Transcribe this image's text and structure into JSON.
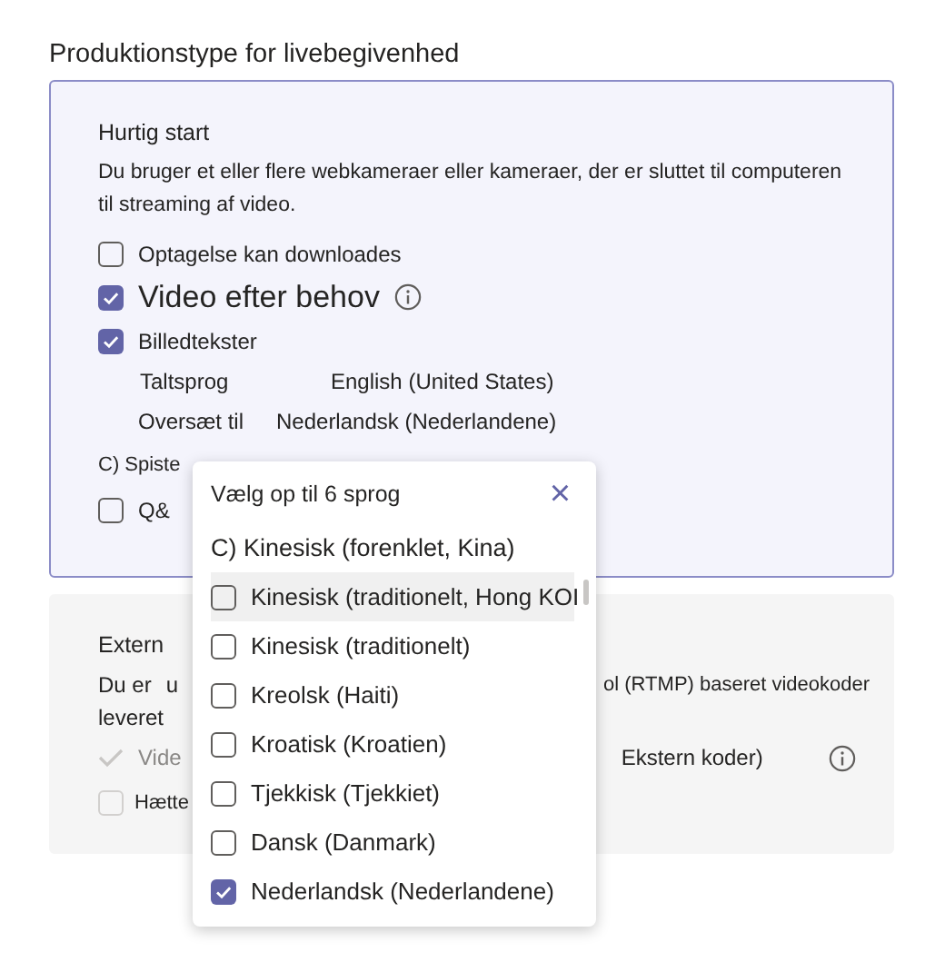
{
  "heading": "Produktionstype for livebegivenhed",
  "quick_start": {
    "title": "Hurtig start",
    "description": "Du bruger et eller flere webkameraer eller kameraer, der er sluttet til computeren til streaming af video.",
    "options": [
      {
        "label": "Optagelse kan downloades",
        "checked": false,
        "kind": "normal"
      },
      {
        "label": "Video efter behov",
        "checked": true,
        "kind": "large"
      },
      {
        "label": "Billedtekster",
        "checked": true,
        "kind": "normal"
      }
    ],
    "settings": [
      {
        "label": "Taltsprog",
        "value": "English (United States)"
      },
      {
        "label": "Oversæt til",
        "value": "Nederlandsk (Nederlandene)"
      }
    ],
    "partial_label": "C) Spiste",
    "qa_option": {
      "label": "Q&",
      "checked": false
    }
  },
  "external": {
    "title": "Extern",
    "description_parts": [
      "Du er",
      "u",
      "ol (RTMP) baseret videokoder",
      "leveret"
    ],
    "video_option": {
      "label": "Vide",
      "checked": true,
      "disabled": true
    },
    "video_suffix": "Ekstern koder)",
    "hood_option": {
      "label": "Hætte",
      "checked": false
    }
  },
  "language_popup": {
    "title": "Vælg op til 6 sprog",
    "close": "×",
    "selected_text": "C) Kinesisk (forenklet, Kina)",
    "items": [
      {
        "label": "Kinesisk (traditionelt, Hong KOI",
        "checked": false,
        "highlighted": true
      },
      {
        "label": "Kinesisk (traditionelt)",
        "checked": false,
        "highlighted": false
      },
      {
        "label": "Kreolsk (Haiti)",
        "checked": false,
        "highlighted": false
      },
      {
        "label": "Kroatisk (Kroatien)",
        "checked": false,
        "highlighted": false
      },
      {
        "label": "Tjekkisk (Tjekkiet)",
        "checked": false,
        "highlighted": false
      },
      {
        "label": "Dansk (Danmark)",
        "checked": false,
        "highlighted": false
      },
      {
        "label": "Nederlandsk (Nederlandene)",
        "checked": true,
        "highlighted": false
      }
    ]
  }
}
